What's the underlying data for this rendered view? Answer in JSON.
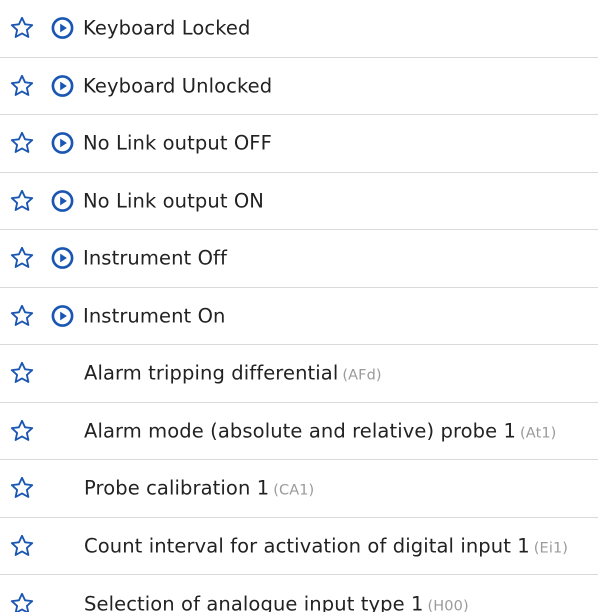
{
  "colors": {
    "accent": "#1a56b3",
    "text": "#222222",
    "code": "#9a9a9a",
    "divider": "#d9d9d9"
  },
  "icons": {
    "favorite": "star-outline-icon",
    "execute": "play-circle-icon"
  },
  "items": [
    {
      "kind": "command",
      "label": "Keyboard Locked"
    },
    {
      "kind": "command",
      "label": "Keyboard Unlocked"
    },
    {
      "kind": "command",
      "label": "No Link output OFF"
    },
    {
      "kind": "command",
      "label": "No Link output ON"
    },
    {
      "kind": "command",
      "label": "Instrument Off"
    },
    {
      "kind": "command",
      "label": "Instrument On"
    },
    {
      "kind": "parameter",
      "label": "Alarm tripping differential",
      "code": "(AFd)"
    },
    {
      "kind": "parameter",
      "label": "Alarm mode (absolute and relative) probe 1",
      "code": "(At1)"
    },
    {
      "kind": "parameter",
      "label": "Probe calibration 1",
      "code": "(CA1)"
    },
    {
      "kind": "parameter",
      "label": "Count interval for activation of digital input 1",
      "code": "(Ei1)"
    },
    {
      "kind": "parameter",
      "label": "Selection of analogue input type 1",
      "code": "(H00)"
    }
  ]
}
